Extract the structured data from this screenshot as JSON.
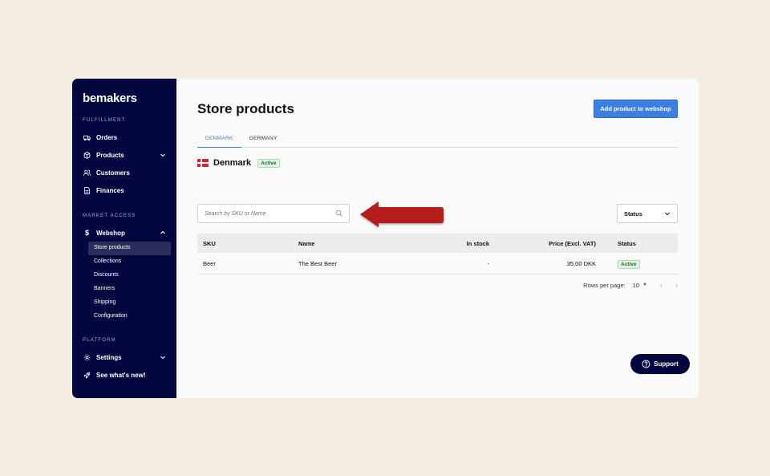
{
  "sidebar": {
    "logo": "bemakers",
    "sections": {
      "fulfillment": "FULFILLMENT",
      "market_access": "MARKET ACCESS",
      "platform": "PLATFORM"
    },
    "items": {
      "orders": "Orders",
      "products": "Products",
      "customers": "Customers",
      "finances": "Finances",
      "webshop": "Webshop",
      "settings": "Settings",
      "whats_new": "See what's new!"
    },
    "webshop_sub": [
      "Store products",
      "Collections",
      "Discounts",
      "Banners",
      "Shipping",
      "Configuration"
    ]
  },
  "main": {
    "title": "Store products",
    "add_button": "Add product to webshop",
    "tabs": [
      "DENMARK",
      "GERMANY"
    ],
    "country": "Denmark",
    "country_status": "Active",
    "search_placeholder": "Search by SKU or Name",
    "status_filter": "Status"
  },
  "table": {
    "headers": [
      "SKU",
      "Name",
      "In stock",
      "Price (Excl. VAT)",
      "Status"
    ],
    "rows": [
      {
        "sku": "Beer",
        "name": "The Best Beer",
        "stock": "-",
        "price": "35,00 DKK",
        "status": "Active"
      }
    ]
  },
  "pagination": {
    "rows_label": "Rows per page:",
    "rows_value": "10",
    "prev": "‹",
    "next": "›"
  },
  "support_label": "Support",
  "colors": {
    "sidebar_bg": "#04073f",
    "accent": "#3d7fe0",
    "arrow": "#b51c1f",
    "background": "#f6eee2"
  }
}
